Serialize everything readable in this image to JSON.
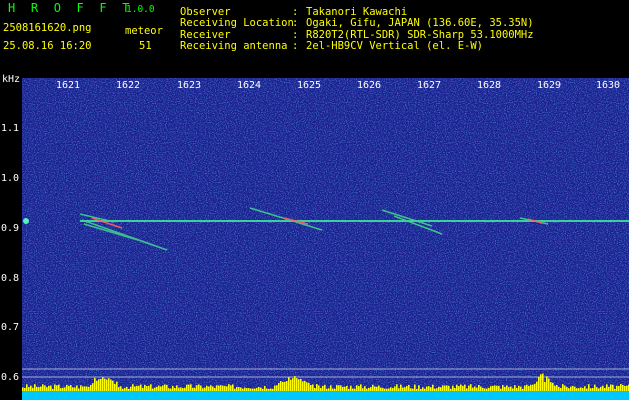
{
  "header": {
    "app_name": "H R O F F T",
    "version": "1.0.0",
    "filename": "2508161620.png",
    "counter_label": "meteor",
    "timestamp": "25.08.16 16:20",
    "counter_value": "51",
    "fields": [
      {
        "label": "Observer",
        "value": "Takanori Kawachi"
      },
      {
        "label": "Receiving Location",
        "value": "Ogaki, Gifu, JAPAN (136.60E, 35.35N)"
      },
      {
        "label": "Receiver",
        "value": "R820T2(RTL-SDR) SDR-Sharp 53.1000MHz"
      },
      {
        "label": "Receiving antenna",
        "value": "2el-HB9CV Vertical (el. E-W)"
      }
    ],
    "separator": ":"
  },
  "plot": {
    "y_unit": "kHz",
    "x_ticks": [
      "1621",
      "1622",
      "1623",
      "1624",
      "1625",
      "1626",
      "1627",
      "1628",
      "1629",
      "1630"
    ],
    "y_ticks": [
      "1.1",
      "1.0",
      "0.9",
      "0.8",
      "0.7",
      "0.6"
    ],
    "colors": {
      "background": "#1b1f8f",
      "carrier": "#3fe0a0",
      "echo": "#40d090",
      "activity": "#ffff00",
      "floor": "#00c8ff",
      "guide_line": "#ffffff"
    }
  }
}
